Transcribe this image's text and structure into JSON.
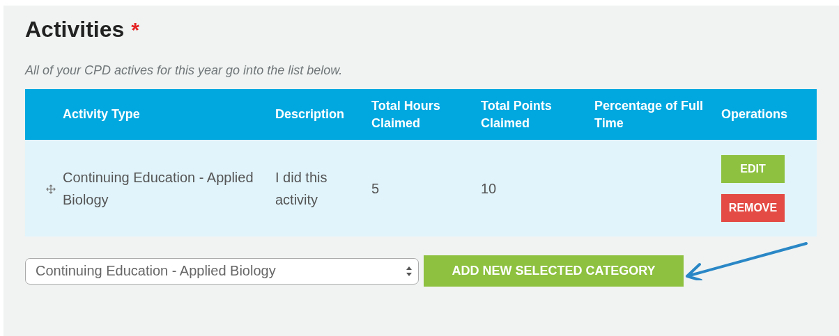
{
  "section": {
    "title": "Activities",
    "required_marker": "*",
    "description": "All of your CPD actives for this year go into the list below."
  },
  "table": {
    "columns": [
      "Activity Type",
      "Description",
      "Total Hours Claimed",
      "Total Points Claimed",
      "Percentage of Full Time",
      "Operations"
    ],
    "rows": [
      {
        "cells": [
          "Continuing Education - Applied Biology",
          "I did this activity",
          "5",
          "10",
          ""
        ],
        "operations": [
          {
            "kind": "edit",
            "label": "EDIT"
          },
          {
            "kind": "remove",
            "label": "REMOVE"
          }
        ]
      }
    ]
  },
  "category_select": {
    "value": "Continuing Education - Applied Biology"
  },
  "add_button": {
    "label": "ADD NEW SELECTED CATEGORY"
  }
}
